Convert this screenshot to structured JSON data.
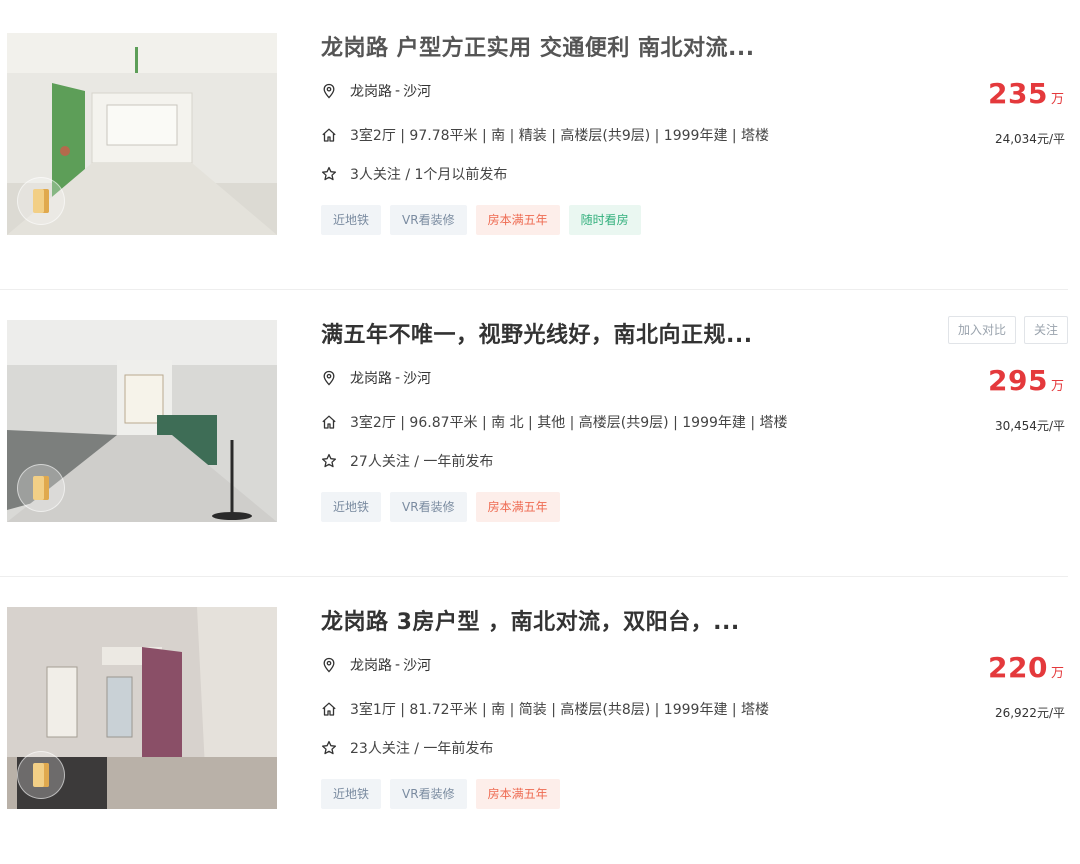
{
  "listings": [
    {
      "title": "龙岗路 户型方正实用 交通便利 南北对流...",
      "location": {
        "area": "龙岗路",
        "separator": "-",
        "district": "沙河"
      },
      "info": "3室2厅 | 97.78平米 | 南 | 精装 | 高楼层(共9层) | 1999年建 | 塔楼",
      "follow": "3人关注 / 1个月以前发布",
      "tags": [
        "近地铁",
        "VR看装修",
        "房本满五年",
        "随时看房"
      ],
      "price": "235",
      "price_unit": "万",
      "unit_price": "24,034元/平"
    },
    {
      "title": "满五年不唯一，视野光线好，南北向正规...",
      "location": {
        "area": "龙岗路",
        "separator": "-",
        "district": "沙河"
      },
      "info": "3室2厅 | 96.87平米 | 南 北 | 其他 | 高楼层(共9层) | 1999年建 | 塔楼",
      "follow": "27人关注 / 一年前发布",
      "tags": [
        "近地铁",
        "VR看装修",
        "房本满五年"
      ],
      "price": "295",
      "price_unit": "万",
      "unit_price": "30,454元/平",
      "actions": {
        "compare": "加入对比",
        "follow": "关注"
      }
    },
    {
      "title": "龙岗路 3房户型 ，南北对流，双阳台，...",
      "location": {
        "area": "龙岗路",
        "separator": "-",
        "district": "沙河"
      },
      "info": "3室1厅 | 81.72平米 | 南 | 简装 | 高楼层(共8层) | 1999年建 | 塔楼",
      "follow": "23人关注 / 一年前发布",
      "tags": [
        "近地铁",
        "VR看装修",
        "房本满五年"
      ],
      "price": "220",
      "price_unit": "万",
      "unit_price": "26,922元/平"
    }
  ],
  "icons": {
    "location": "location-pin-icon",
    "house": "house-icon",
    "star": "star-icon",
    "vr": "vr-cube-icon"
  },
  "colors": {
    "price": "#e4393c",
    "tag_gray_bg": "#f1f4f7",
    "tag_red_bg": "#fdeeea",
    "tag_green_bg": "#eaf7f1"
  }
}
